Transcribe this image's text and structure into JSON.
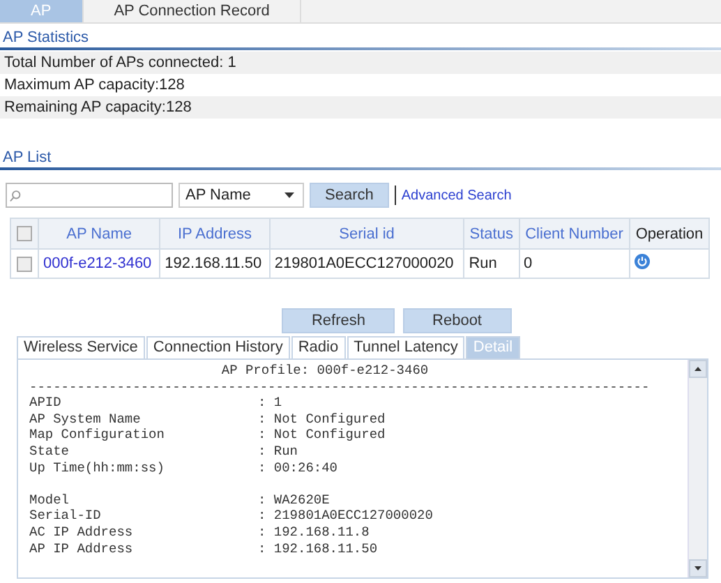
{
  "tabs": [
    {
      "label": "AP",
      "selected": true
    },
    {
      "label": "AP Connection Record",
      "selected": false
    }
  ],
  "statistics": {
    "title": "AP Statistics",
    "rows": [
      "Total Number of APs connected: 1",
      "Maximum AP capacity:128",
      "Remaining AP capacity:128"
    ]
  },
  "ap_list": {
    "title": "AP List",
    "search": {
      "filter": "AP Name",
      "button": "Search",
      "advanced": "Advanced Search"
    },
    "columns": [
      {
        "label": "AP Name",
        "sortable": true
      },
      {
        "label": "IP Address",
        "sortable": true
      },
      {
        "label": "Serial id",
        "sortable": true
      },
      {
        "label": "Status",
        "sortable": true
      },
      {
        "label": "Client Number",
        "sortable": true
      },
      {
        "label": "Operation",
        "sortable": false
      }
    ],
    "header_checked": false,
    "rows": [
      {
        "checked": false,
        "ap_name": "000f-e212-3460",
        "ip": "192.168.11.50",
        "serial": "219801A0ECC127000020",
        "status": "Run",
        "clients": "0"
      }
    ]
  },
  "actions": [
    "Refresh",
    "Reboot"
  ],
  "detail_tabs": [
    {
      "label": "Wireless Service",
      "selected": false
    },
    {
      "label": "Connection History",
      "selected": false
    },
    {
      "label": "Radio",
      "selected": false
    },
    {
      "label": "Tunnel Latency",
      "selected": false
    },
    {
      "label": "Detail",
      "selected": true
    }
  ],
  "detail": {
    "lines": [
      {
        "kind": "title",
        "text": "AP Profile: 000f-e212-3460"
      },
      {
        "kind": "rule",
        "text": "------------------------------------------------------------------------------"
      },
      {
        "kind": "field",
        "label": "APID",
        "value": ": 1"
      },
      {
        "kind": "field",
        "label": "AP System Name",
        "value": ": Not Configured"
      },
      {
        "kind": "field",
        "label": "Map Configuration",
        "value": ": Not Configured"
      },
      {
        "kind": "field",
        "label": "State",
        "value": ": Run"
      },
      {
        "kind": "field",
        "label": "Up Time(hh:mm:ss)",
        "value": ": 00:26:40"
      },
      {
        "kind": "blank"
      },
      {
        "kind": "field",
        "label": "Model",
        "value": ": WA2620E"
      },
      {
        "kind": "field",
        "label": "Serial-ID",
        "value": ": 219801A0ECC127000020"
      },
      {
        "kind": "field",
        "label": "AC IP Address",
        "value": ": 192.168.11.8"
      },
      {
        "kind": "field",
        "label": "AP IP Address",
        "value": ": 192.168.11.50"
      }
    ]
  }
}
